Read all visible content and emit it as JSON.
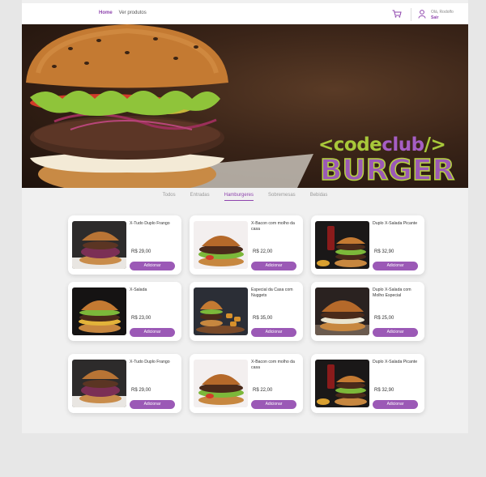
{
  "nav": {
    "links": [
      "Home",
      "Ver produtos"
    ],
    "user_greeting": "Olá, Rodolfo",
    "user_action": "Sair",
    "icons": [
      "cart-icon",
      "user-icon"
    ]
  },
  "banner": {
    "brand_left": "<code",
    "brand_mid": "club",
    "brand_right": "/>",
    "brand_word": "BURGER"
  },
  "tabs": [
    "Todos",
    "Entradas",
    "Hamburgeres",
    "Sobremesas",
    "Bebidas"
  ],
  "active_tab": "Hamburgeres",
  "colors": {
    "accent": "#9b59b6",
    "brand_green": "#a8c83a"
  },
  "products": [
    {
      "title": "X-Tudo Duplo Frango",
      "price": "R$ 29,00",
      "button": "Adicionar"
    },
    {
      "title": "X-Bacon com molho da casa",
      "price": "R$ 22,00",
      "button": "Adicionar"
    },
    {
      "title": "Duplo X-Salada Picante",
      "price": "R$ 32,90",
      "button": "Adicionar"
    },
    {
      "title": "X-Salada",
      "price": "R$ 23,00",
      "button": "Adicionar"
    },
    {
      "title": "Especial da Casa com Nuggets",
      "price": "R$ 35,00",
      "button": "Adicionar"
    },
    {
      "title": "Duplo X-Salada com Molho Especial",
      "price": "R$ 25,00",
      "button": "Adicionar"
    },
    {
      "title": "X-Tudo Duplo Frango",
      "price": "R$ 29,00",
      "button": "Adicionar"
    },
    {
      "title": "X-Bacon com molho da casa",
      "price": "R$ 22,00",
      "button": "Adicionar"
    },
    {
      "title": "Duplo X-Salada Picante",
      "price": "R$ 32,90",
      "button": "Adicionar"
    }
  ]
}
